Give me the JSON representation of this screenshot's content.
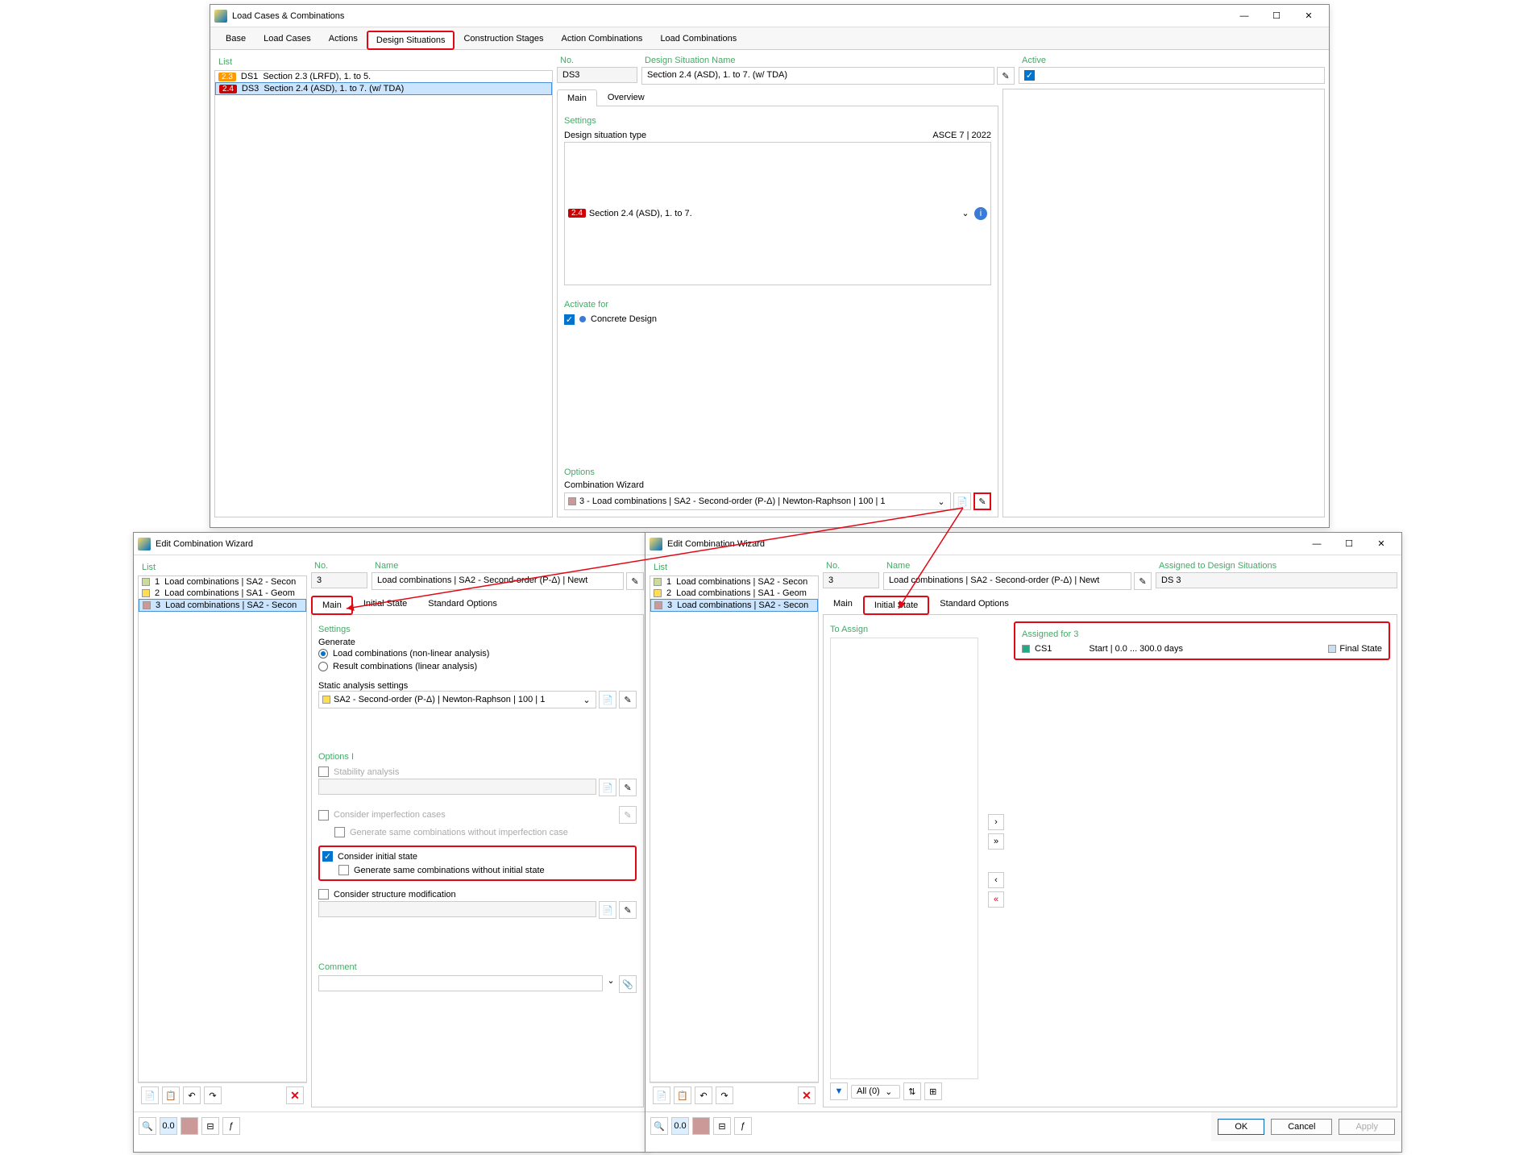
{
  "main": {
    "title": "Load Cases & Combinations",
    "tabs": [
      "Base",
      "Load Cases",
      "Actions",
      "Design Situations",
      "Construction Stages",
      "Action Combinations",
      "Load Combinations"
    ],
    "active_tab": 3,
    "list_label": "List",
    "rows": [
      {
        "badge": "2.3",
        "badge_cls": "b-orange",
        "id": "DS1",
        "name": "Section 2.3 (LRFD), 1. to 5."
      },
      {
        "badge": "2.4",
        "badge_cls": "b-red",
        "id": "DS3",
        "name": "Section 2.4 (ASD), 1. to 7. (w/ TDA)"
      }
    ],
    "no_label": "No.",
    "no_value": "DS3",
    "name_label": "Design Situation Name",
    "name_value": "Section 2.4 (ASD), 1. to 7. (w/ TDA)",
    "active_label": "Active",
    "subtabs": [
      "Main",
      "Overview"
    ],
    "settings_label": "Settings",
    "ds_type_label": "Design situation type",
    "ds_type_std": "ASCE 7 | 2022",
    "ds_type_value": "Section 2.4 (ASD), 1. to 7.",
    "activate_label": "Activate for",
    "activate_item": "Concrete Design",
    "options_label": "Options",
    "cw_label": "Combination Wizard",
    "cw_value": "3 - Load combinations | SA2 - Second-order (P-Δ) | Newton-Raphson | 100 | 1"
  },
  "wiz1": {
    "title": "Edit Combination Wizard",
    "list_label": "List",
    "rows": [
      {
        "id": "1",
        "name": "Load combinations | SA2 - Secon"
      },
      {
        "id": "2",
        "name": "Load combinations | SA1 - Geom"
      },
      {
        "id": "3",
        "name": "Load combinations | SA2 - Secon"
      }
    ],
    "no_label": "No.",
    "no_value": "3",
    "name_label": "Name",
    "name_value": "Load combinations | SA2 - Second-order (P-Δ) | Newt",
    "tabs": [
      "Main",
      "Initial State",
      "Standard Options"
    ],
    "settings": "Settings",
    "generate": "Generate",
    "gen_nl": "Load combinations (non-linear analysis)",
    "gen_lin": "Result combinations (linear analysis)",
    "sas_label": "Static analysis settings",
    "sas_value": "SA2 - Second-order (P-Δ) | Newton-Raphson | 100 | 1",
    "options1": "Options I",
    "stability": "Stability analysis",
    "imperfection": "Consider imperfection cases",
    "imperfection_sub": "Generate same combinations without imperfection case",
    "initial": "Consider initial state",
    "initial_sub": "Generate same combinations without initial state",
    "structmod": "Consider structure modification",
    "comment": "Comment"
  },
  "wiz2": {
    "title": "Edit Combination Wizard",
    "list_label": "List",
    "rows": [
      {
        "id": "1",
        "name": "Load combinations | SA2 - Secon"
      },
      {
        "id": "2",
        "name": "Load combinations | SA1 - Geom"
      },
      {
        "id": "3",
        "name": "Load combinations | SA2 - Secon"
      }
    ],
    "no_label": "No.",
    "no_value": "3",
    "name_label": "Name",
    "name_value": "Load combinations | SA2 - Second-order (P-Δ) | Newt",
    "assigned_label": "Assigned to Design Situations",
    "assigned_value": "DS 3",
    "tabs": [
      "Main",
      "Initial State",
      "Standard Options"
    ],
    "toassign": "To Assign",
    "assigned_for": "Assigned for 3",
    "cs1": "CS1",
    "range": "Start | 0.0 ... 300.0 days",
    "final": "Final State",
    "filter": "All (0)",
    "ok": "OK",
    "cancel": "Cancel",
    "apply": "Apply"
  }
}
